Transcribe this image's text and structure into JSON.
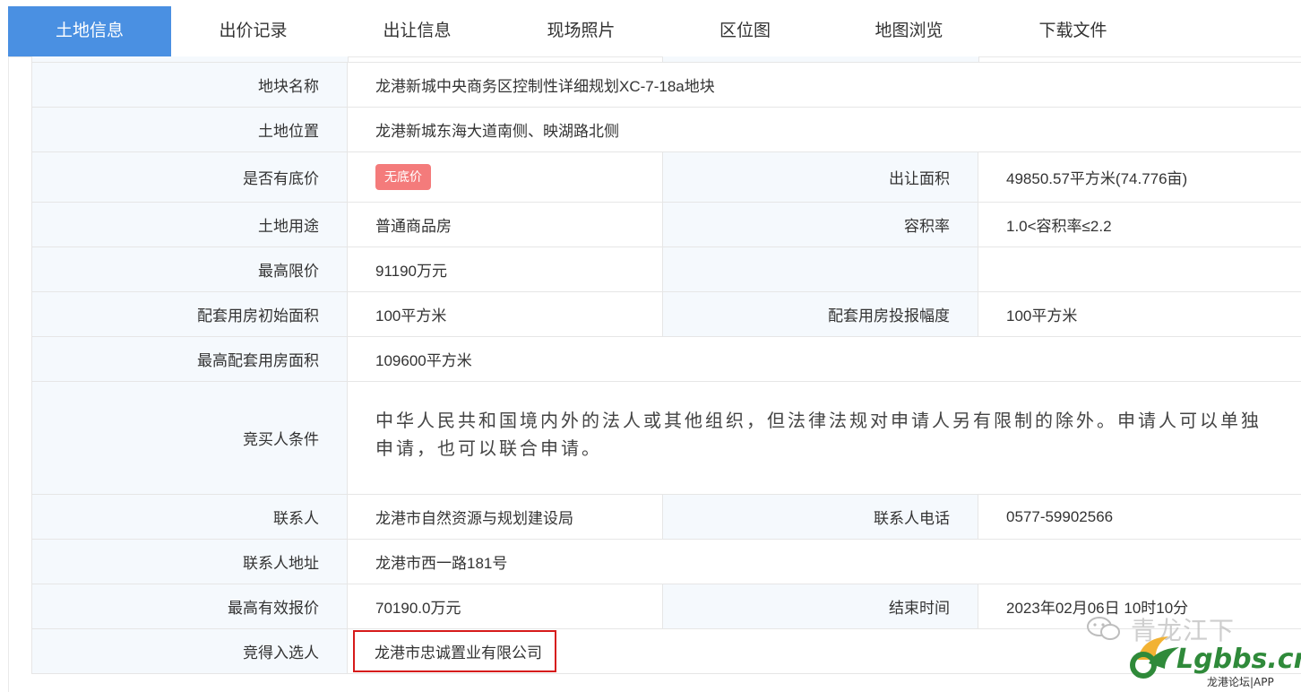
{
  "tabs": [
    {
      "label": "土地信息",
      "active": true
    },
    {
      "label": "出价记录",
      "active": false
    },
    {
      "label": "出让信息",
      "active": false
    },
    {
      "label": "现场照片",
      "active": false
    },
    {
      "label": "区位图",
      "active": false
    },
    {
      "label": "地图浏览",
      "active": false
    },
    {
      "label": "下载文件",
      "active": false
    }
  ],
  "info": {
    "plot_name": {
      "label": "地块名称",
      "value": "龙港新城中央商务区控制性详细规划XC-7-18a地块"
    },
    "location": {
      "label": "土地位置",
      "value": "龙港新城东海大道南侧、映湖路北侧"
    },
    "reserve_price": {
      "label": "是否有底价",
      "badge": "无底价"
    },
    "area": {
      "label": "出让面积",
      "value": "49850.57平方米(74.776亩)"
    },
    "usage": {
      "label": "土地用途",
      "value": "普通商品房"
    },
    "plot_ratio": {
      "label": "容积率",
      "value": "1.0<容积率≤2.2"
    },
    "price_cap": {
      "label": "最高限价",
      "value": "91190万元"
    },
    "housing_initial": {
      "label": "配套用房初始面积",
      "value": "100平方米"
    },
    "housing_increment": {
      "label": "配套用房投报幅度",
      "value": "100平方米"
    },
    "housing_max": {
      "label": "最高配套用房面积",
      "value": "109600平方米"
    },
    "conditions": {
      "label": "竞买人条件",
      "value": "中华人民共和国境内外的法人或其他组织，但法律法规对申请人另有限制的除外。申请人可以单独申请，也可以联合申请。"
    },
    "contact": {
      "label": "联系人",
      "value": "龙港市自然资源与规划建设局"
    },
    "contact_phone": {
      "label": "联系人电话",
      "value": "0577-59902566"
    },
    "contact_address": {
      "label": "联系人地址",
      "value": "龙港市西一路181号"
    },
    "max_bid": {
      "label": "最高有效报价",
      "value": "70190.0万元"
    },
    "end_time": {
      "label": "结束时间",
      "value": "2023年02月06日 10时10分"
    },
    "winner": {
      "label": "竞得入选人",
      "value": "龙港市忠诚置业有限公司"
    }
  },
  "watermark": {
    "channel": "青龙江下",
    "site": "Lgbbs.cn",
    "app": "龙港论坛|APP"
  },
  "colors": {
    "tab_active": "#4a90e2",
    "label_bg": "#f5f9fd",
    "badge": "#f47b7b",
    "highlight_border": "#d61a1a"
  }
}
